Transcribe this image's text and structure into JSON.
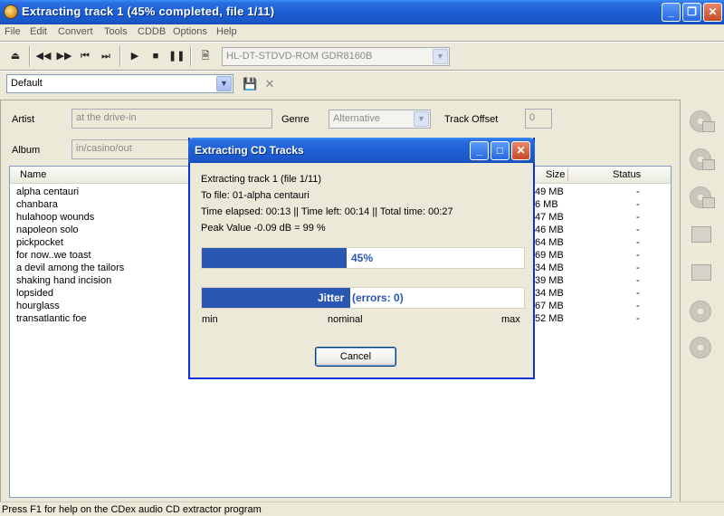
{
  "window": {
    "title": "Extracting track 1 (45% completed, file 1/11)"
  },
  "menu": [
    "File",
    "Edit",
    "Convert",
    "Tools",
    "CDDB",
    "Options",
    "Help"
  ],
  "toolbar": {
    "drive": "HL-DT-STDVD-ROM GDR8160B",
    "icons": [
      "eject-icon",
      "rewind-icon",
      "fast-forward-icon",
      "previous-track-icon",
      "next-track-icon",
      "play-icon",
      "stop-icon",
      "pause-icon",
      "track-info-icon"
    ]
  },
  "profile": {
    "value": "Default"
  },
  "album_info": {
    "artist_label": "Artist",
    "artist": "at the drive-in",
    "album_label": "Album",
    "album": "in/casino/out",
    "genre_label": "Genre",
    "genre": "Alternative",
    "offset_label": "Track Offset",
    "offset": "0"
  },
  "tracks": {
    "headers": {
      "name": "Name",
      "size": "Size",
      "status": "Status"
    },
    "rows": [
      {
        "name": "alpha centauri",
        "size": "49 MB",
        "status": "-"
      },
      {
        "name": "chanbara",
        "size": "6 MB",
        "status": "-"
      },
      {
        "name": "hulahoop wounds",
        "size": "47 MB",
        "status": "-"
      },
      {
        "name": "napoleon solo",
        "size": "46 MB",
        "status": "-"
      },
      {
        "name": "pickpocket",
        "size": "64 MB",
        "status": "-"
      },
      {
        "name": "for now..we toast",
        "size": "69 MB",
        "status": "-"
      },
      {
        "name": "a devil among the tailors",
        "size": "34 MB",
        "status": "-"
      },
      {
        "name": "shaking hand incision",
        "size": "39 MB",
        "status": "-"
      },
      {
        "name": "lopsided",
        "size": "34 MB",
        "status": "-"
      },
      {
        "name": "hourglass",
        "size": "67 MB",
        "status": "-"
      },
      {
        "name": "transatlantic foe",
        "size": "52 MB",
        "status": "-"
      }
    ]
  },
  "dialog": {
    "title": "Extracting CD Tracks",
    "line1": "Extracting track 1  (file 1/11)",
    "line2": "To file: 01-alpha centauri",
    "line3": "Time elapsed: 00:13  ||  Time left: 00:14  ||  Total time: 00:27",
    "line4": "Peak Value -0.09 dB =  99 %",
    "progress": 0.45,
    "progress_label": "45%",
    "jitter_fill": 0.46,
    "jitter_label": "Jitter",
    "jitter_errors": "(errors: 0)",
    "scale_min": "min",
    "scale_nominal": "nominal",
    "scale_max": "max",
    "cancel_label": "Cancel"
  },
  "colors": {
    "titlebar": "#1d5fd6",
    "progress_fill": "#2a57b2",
    "dialog_border": "#0831d9"
  },
  "status_bar": "Press F1 for help on the CDex audio CD extractor program"
}
